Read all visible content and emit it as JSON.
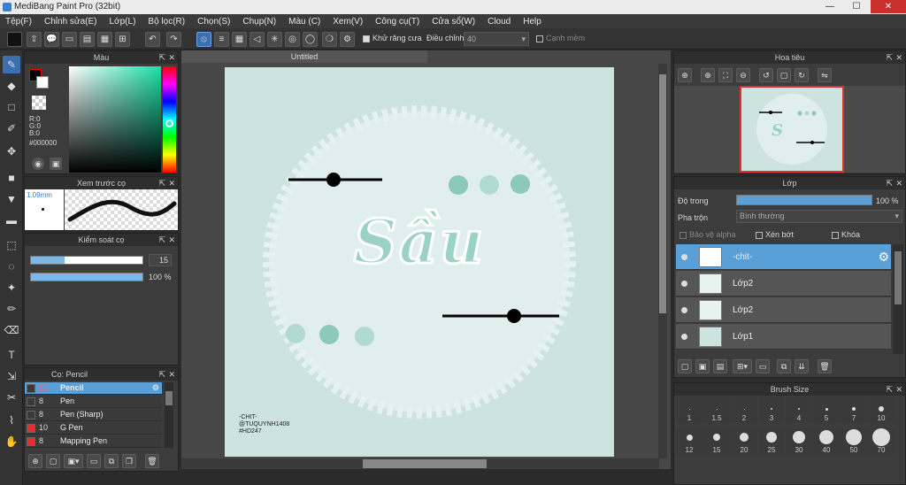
{
  "window": {
    "title": "MediBang Paint Pro (32bit)",
    "min": "—",
    "max": "☐",
    "close": "✕"
  },
  "menu": [
    "Tệp(F)",
    "Chỉnh sửa(E)",
    "Lớp(L)",
    "Bộ lọc(R)",
    "Chọn(S)",
    "Chụp(N)",
    "Màu (C)",
    "Xem(V)",
    "Công cụ(T)",
    "Cửa sổ(W)",
    "Cloud",
    "Help"
  ],
  "toolbar": {
    "antialias_label": "Khử răng cưa",
    "adjust_label": "Điều chỉnh",
    "adjust_value": "40",
    "soft_edge_label": "Cạnh mềm"
  },
  "color_panel": {
    "title": "Màu",
    "r": "R:0",
    "g": "G:0",
    "b": "B:0",
    "hex": "#000000"
  },
  "brush_preview": {
    "title": "Xem trước cọ",
    "size": "1.09mm"
  },
  "brush_control": {
    "title": "Kiểm soát cọ",
    "size_value": "15",
    "opacity_value": "100 %"
  },
  "brushes": {
    "title": "Cọ: Pencil",
    "items": [
      {
        "size": "15",
        "name": "Pencil",
        "color": "#3a3a3a",
        "selected": true
      },
      {
        "size": "8",
        "name": "Pen",
        "color": "#3a3a3a",
        "selected": false
      },
      {
        "size": "8",
        "name": "Pen (Sharp)",
        "color": "#3a3a3a",
        "selected": false
      },
      {
        "size": "10",
        "name": "G Pen",
        "color": "#e03030",
        "selected": false
      },
      {
        "size": "8",
        "name": "Mapping Pen",
        "color": "#e03030",
        "selected": false
      }
    ]
  },
  "document": {
    "tab": "Untitled",
    "title_text": "Sầu",
    "signature": "-CHIT-\n@TUQUYNH1408\n#HD247"
  },
  "navigator": {
    "title": "Hoa tiêu"
  },
  "layers": {
    "title": "Lớp",
    "opacity_label": "Độ trong",
    "opacity_value": "100 %",
    "blend_label": "Pha trộn",
    "blend_value": "Bình thường",
    "protect_alpha": "Bảo vệ alpha",
    "clip": "Xén bớt",
    "lock": "Khóa",
    "items": [
      {
        "name": "-chit-",
        "selected": true
      },
      {
        "name": "Lớp2",
        "selected": false
      },
      {
        "name": "Lớp2",
        "selected": false
      },
      {
        "name": "Lớp1",
        "selected": false
      }
    ]
  },
  "brush_size": {
    "title": "Brush Size",
    "row1": [
      "1",
      "1.5",
      "2",
      "3",
      "4",
      "5",
      "7",
      "10"
    ],
    "row2": [
      "12",
      "15",
      "20",
      "25",
      "30",
      "40",
      "50",
      "70"
    ]
  },
  "colors": {
    "accent": "#5aa0d8",
    "paper": "#cde3de",
    "teal": "#8cc9b8"
  }
}
